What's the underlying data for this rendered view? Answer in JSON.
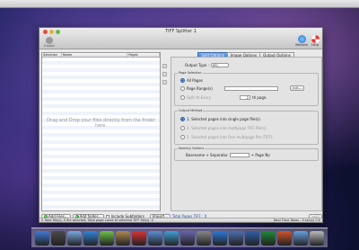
{
  "window": {
    "title": "TIFF Splitter 1"
  },
  "toolbar": {
    "export_label": "Export",
    "website_label": "Website",
    "help_label": "Help"
  },
  "file_list": {
    "columns": [
      "Selection",
      "Name",
      "Pages"
    ],
    "drop_hint": "Drag and Drop your files directly from the finder here."
  },
  "tabs": [
    "Split Options",
    "Image Options",
    "Output Options"
  ],
  "split": {
    "output_type_label": "Output Type :",
    "output_type_value": "JPG",
    "page_selection_title": "Page Selection",
    "all_pages": "All Pages",
    "page_ranges": "Page Range(s)",
    "edit_label": "Edit...",
    "split_every": "Split At Every",
    "split_every_value": "2",
    "th_page": "th page.",
    "output_method_title": "Output Method",
    "method1": "1. Selected pages into single page file(s).",
    "method2": "2. Selected pages into multipage TIFF file(s).",
    "method3": "3. Selected pages into One multipage file (TIFF).",
    "naming_title": "Naming Options",
    "naming_prefix": "Basename + Separator",
    "naming_suffix": "+ Page No"
  },
  "bottom": {
    "add_files": "Add Files...",
    "add_folder": "Add folder...",
    "include_sub": "Include Subfolders",
    "import": "Import...",
    "total_pages": "Total Pages TIFF : 0",
    "split": "Split"
  },
  "status": {
    "left": "0 Total file(s); 0 file selected; Total page count of selected TIFF file(s): 0",
    "right": "Total Time Takes : 0 sec(s) 0:0"
  },
  "dock_icons": [
    "finder-icon",
    "dashboard-icon",
    "mail-icon",
    "safari-icon",
    "ichat-icon",
    "address-book-icon",
    "ical-icon",
    "preview-icon",
    "itunes-icon",
    "iphoto-icon",
    "system-preferences-icon",
    "app-store-icon",
    "xcode-icon",
    "word-icon",
    "excel-icon",
    "powerpoint-icon",
    "downloads-icon",
    "trash-icon"
  ],
  "colors": {
    "accent": "#3c7fd6",
    "close": "#e94a41"
  }
}
